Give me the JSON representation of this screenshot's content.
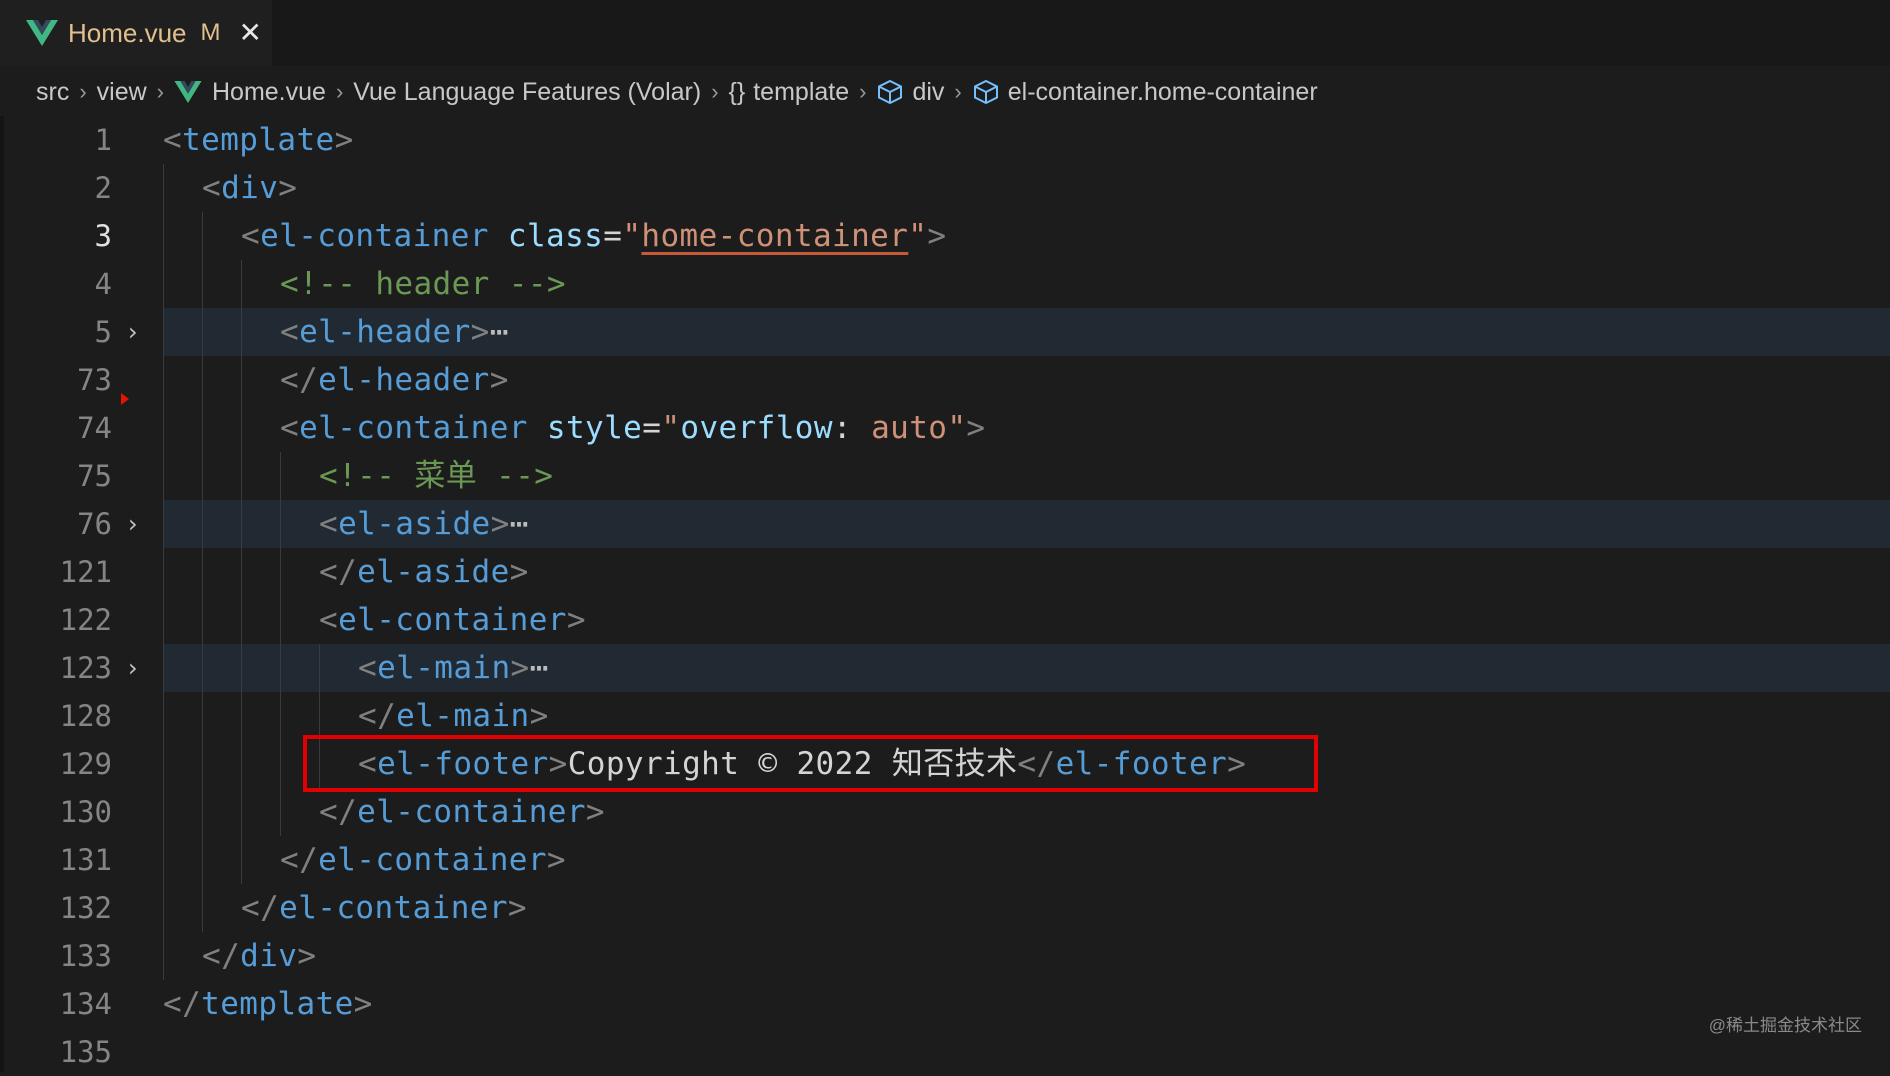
{
  "tab": {
    "filename": "Home.vue",
    "status": "M",
    "close": "✕"
  },
  "breadcrumb": [
    {
      "label": "src",
      "icon": ""
    },
    {
      "label": "view",
      "icon": ""
    },
    {
      "label": "Home.vue",
      "icon": "vue-icon"
    },
    {
      "label": "Vue Language Features (Volar)",
      "icon": ""
    },
    {
      "label": "template",
      "icon": "braces-icon"
    },
    {
      "label": "div",
      "icon": "cube-icon"
    },
    {
      "label": "el-container.home-container",
      "icon": "cube-icon"
    }
  ],
  "colors": {
    "accent": "#41b883",
    "highlight_box": "#e30000",
    "tab_text": "#e2c08d"
  },
  "lines": [
    {
      "num": "1",
      "folded": false,
      "tokens": [
        [
          "br",
          "<"
        ],
        [
          "tag",
          "template"
        ],
        [
          "br",
          ">"
        ]
      ]
    },
    {
      "num": "2",
      "folded": false,
      "tokens": [
        [
          "br",
          "<"
        ],
        [
          "tag",
          "div"
        ],
        [
          "br",
          ">"
        ]
      ]
    },
    {
      "num": "3",
      "folded": false,
      "tokens": [
        [
          "br",
          "<"
        ],
        [
          "tag",
          "el-container"
        ],
        [
          "txt",
          " "
        ],
        [
          "attr",
          "class"
        ],
        [
          "eq",
          "="
        ],
        [
          "str",
          "\""
        ],
        [
          "strU",
          "home-container"
        ],
        [
          "str",
          "\""
        ],
        [
          "br",
          ">"
        ]
      ]
    },
    {
      "num": "4",
      "folded": false,
      "tokens": [
        [
          "cmt",
          "<!-- header -->"
        ]
      ]
    },
    {
      "num": "5",
      "folded": true,
      "tokens": [
        [
          "br",
          "<"
        ],
        [
          "tag",
          "el-header"
        ],
        [
          "br",
          ">"
        ],
        [
          "ell",
          "⋯"
        ]
      ]
    },
    {
      "num": "73",
      "folded": false,
      "tokens": [
        [
          "br",
          "</"
        ],
        [
          "tag",
          "el-header"
        ],
        [
          "br",
          ">"
        ]
      ]
    },
    {
      "num": "74",
      "folded": false,
      "tokens": [
        [
          "br",
          "<"
        ],
        [
          "tag",
          "el-container"
        ],
        [
          "txt",
          " "
        ],
        [
          "attr",
          "style"
        ],
        [
          "eq",
          "="
        ],
        [
          "str",
          "\""
        ],
        [
          "attr",
          "overflow"
        ],
        [
          "eq",
          ": "
        ],
        [
          "str",
          "auto"
        ],
        [
          "str",
          "\""
        ],
        [
          "br",
          ">"
        ]
      ]
    },
    {
      "num": "75",
      "folded": false,
      "tokens": [
        [
          "cmt",
          "<!-- 菜单 -->"
        ]
      ]
    },
    {
      "num": "76",
      "folded": true,
      "tokens": [
        [
          "br",
          "<"
        ],
        [
          "tag",
          "el-aside"
        ],
        [
          "br",
          ">"
        ],
        [
          "ell",
          "⋯"
        ]
      ]
    },
    {
      "num": "121",
      "folded": false,
      "tokens": [
        [
          "br",
          "</"
        ],
        [
          "tag",
          "el-aside"
        ],
        [
          "br",
          ">"
        ]
      ]
    },
    {
      "num": "122",
      "folded": false,
      "tokens": [
        [
          "br",
          "<"
        ],
        [
          "tag",
          "el-container"
        ],
        [
          "br",
          ">"
        ]
      ]
    },
    {
      "num": "123",
      "folded": true,
      "tokens": [
        [
          "br",
          "<"
        ],
        [
          "tag",
          "el-main"
        ],
        [
          "br",
          ">"
        ],
        [
          "ell",
          "⋯"
        ]
      ]
    },
    {
      "num": "128",
      "folded": false,
      "tokens": [
        [
          "br",
          "</"
        ],
        [
          "tag",
          "el-main"
        ],
        [
          "br",
          ">"
        ]
      ]
    },
    {
      "num": "129",
      "folded": false,
      "tokens": [
        [
          "br",
          "<"
        ],
        [
          "tag",
          "el-footer"
        ],
        [
          "br",
          ">"
        ],
        [
          "txt",
          "Copyright © 2022 知否技术"
        ],
        [
          "br",
          "</"
        ],
        [
          "tag",
          "el-footer"
        ],
        [
          "br",
          ">"
        ]
      ]
    },
    {
      "num": "130",
      "folded": false,
      "tokens": [
        [
          "br",
          "</"
        ],
        [
          "tag",
          "el-container"
        ],
        [
          "br",
          ">"
        ]
      ]
    },
    {
      "num": "131",
      "folded": false,
      "tokens": [
        [
          "br",
          "</"
        ],
        [
          "tag",
          "el-container"
        ],
        [
          "br",
          ">"
        ]
      ]
    },
    {
      "num": "132",
      "folded": false,
      "tokens": [
        [
          "br",
          "</"
        ],
        [
          "tag",
          "el-container"
        ],
        [
          "br",
          ">"
        ]
      ]
    },
    {
      "num": "133",
      "folded": false,
      "tokens": [
        [
          "br",
          "</"
        ],
        [
          "tag",
          "div"
        ],
        [
          "br",
          ">"
        ]
      ]
    },
    {
      "num": "134",
      "folded": false,
      "tokens": [
        [
          "br",
          "</"
        ],
        [
          "tag",
          "template"
        ],
        [
          "br",
          ">"
        ]
      ]
    },
    {
      "num": "135",
      "folded": false,
      "tokens": []
    }
  ],
  "watermark": "@稀土掘金技术社区"
}
